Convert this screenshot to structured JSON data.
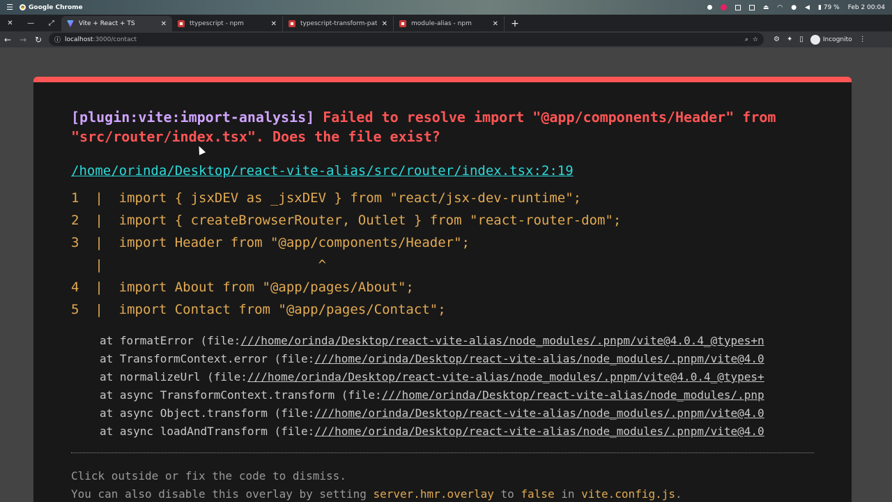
{
  "os": {
    "app_name": "Google Chrome",
    "battery": "79 %",
    "datetime": "Feb 2  00:04"
  },
  "tabs": [
    {
      "title": "Vite + React + TS",
      "favicon": "vite-icon",
      "active": true
    },
    {
      "title": "ttypescript - npm",
      "favicon": "npm-icon",
      "active": false
    },
    {
      "title": "typescript-transform-paths",
      "favicon": "npm-icon",
      "active": false
    },
    {
      "title": "module-alias - npm",
      "favicon": "npm-icon",
      "active": false
    }
  ],
  "address": {
    "host": "localhost",
    "path": ":3000/contact",
    "profile": "Incognito"
  },
  "error": {
    "plugin": "[plugin:vite:import-analysis]",
    "message": "Failed to resolve import \"@app/components/Header\" from \"src/router/index.tsx\". Does the file exist?",
    "file": "/home/orinda/Desktop/react-vite-alias/src/router/index.tsx:2:19",
    "frame": [
      "1  |  import { jsxDEV as _jsxDEV } from \"react/jsx-dev-runtime\";",
      "2  |  import { createBrowserRouter, Outlet } from \"react-router-dom\";",
      "3  |  import Header from \"@app/components/Header\";",
      "   |                           ^",
      "4  |  import About from \"@app/pages/About\";",
      "5  |  import Contact from \"@app/pages/Contact\";"
    ],
    "stack": [
      {
        "prefix": "at formatError (file:",
        "link": "///home/orinda/Desktop/react-vite-alias/node_modules/.pnpm/vite@4.0.4_@types+n"
      },
      {
        "prefix": "at TransformContext.error (file:",
        "link": "///home/orinda/Desktop/react-vite-alias/node_modules/.pnpm/vite@4.0"
      },
      {
        "prefix": "at normalizeUrl (file:",
        "link": "///home/orinda/Desktop/react-vite-alias/node_modules/.pnpm/vite@4.0.4_@types+"
      },
      {
        "prefix": "at async TransformContext.transform (file:",
        "link": "///home/orinda/Desktop/react-vite-alias/node_modules/.pnp"
      },
      {
        "prefix": "at async Object.transform (file:",
        "link": "///home/orinda/Desktop/react-vite-alias/node_modules/.pnpm/vite@4.0"
      },
      {
        "prefix": "at async loadAndTransform (file:",
        "link": "///home/orinda/Desktop/react-vite-alias/node_modules/.pnpm/vite@4.0"
      }
    ],
    "tip_line1": "Click outside or fix the code to dismiss.",
    "tip_line2_a": "You can also disable this overlay by setting ",
    "tip_line2_code1": "server.hmr.overlay",
    "tip_line2_b": " to ",
    "tip_line2_code2": "false",
    "tip_line2_c": " in ",
    "tip_line2_code3": "vite.config.js",
    "tip_line2_d": "."
  },
  "colors": {
    "overlay_accent": "#ff5555",
    "plugin_text": "#cfa4ff",
    "file_link": "#2dd9da",
    "code_text": "#e2aa53"
  }
}
